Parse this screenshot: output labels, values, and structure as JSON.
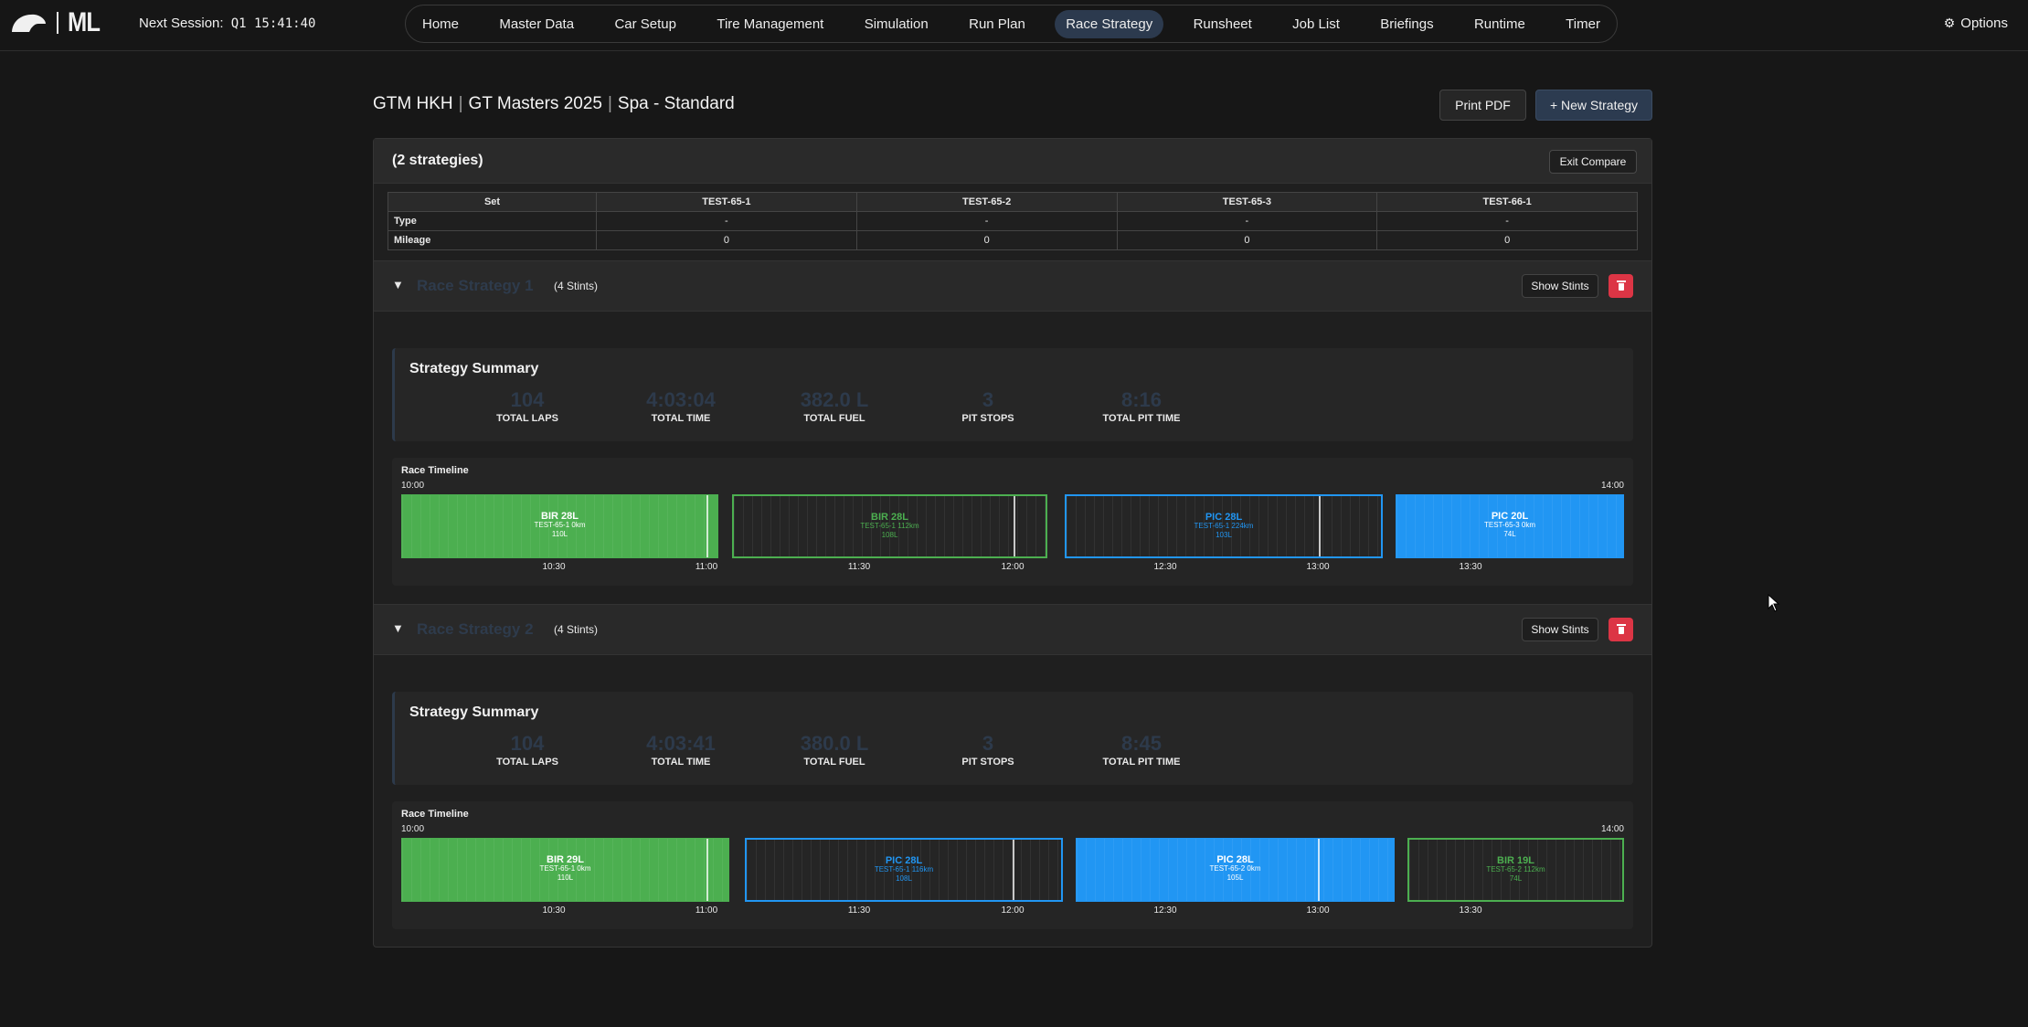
{
  "header": {
    "logo_text": "ML",
    "next_session_label": "Next Session:",
    "next_session_value": "Q1 15:41:40",
    "nav": [
      "Home",
      "Master Data",
      "Car Setup",
      "Tire Management",
      "Simulation",
      "Run Plan",
      "Race Strategy",
      "Runsheet",
      "Job List",
      "Briefings",
      "Runtime",
      "Timer"
    ],
    "active_nav": "Race Strategy",
    "options_label": "Options"
  },
  "page": {
    "crumb_team": "GTM HKH",
    "crumb_series": "GT Masters 2025",
    "crumb_track": "Spa - Standard",
    "print_label": "Print PDF",
    "new_strategy_label": "+ New Strategy"
  },
  "compare": {
    "title": "(2 strategies)",
    "exit_label": "Exit Compare",
    "table": {
      "header_label": "Set",
      "sets": [
        "TEST-65-1",
        "TEST-65-2",
        "TEST-65-3",
        "TEST-66-1"
      ],
      "rows": [
        {
          "label": "Type",
          "values": [
            "-",
            "-",
            "-",
            "-"
          ]
        },
        {
          "label": "Mileage",
          "values": [
            "0",
            "0",
            "0",
            "0"
          ]
        }
      ]
    }
  },
  "strategies": [
    {
      "name": "Race Strategy 1",
      "stints_label": "(4 Stints)",
      "show_stints_label": "Show Stints",
      "summary_title": "Strategy Summary",
      "metrics": [
        {
          "value": "104",
          "label": "TOTAL LAPS"
        },
        {
          "value": "4:03:04",
          "label": "TOTAL TIME"
        },
        {
          "value": "382.0 L",
          "label": "TOTAL FUEL"
        },
        {
          "value": "3",
          "label": "PIT STOPS"
        },
        {
          "value": "8:16",
          "label": "TOTAL PIT TIME"
        }
      ],
      "timeline": {
        "title": "Race Timeline",
        "start": "10:00",
        "end": "14:00",
        "ticks": [
          "10:30",
          "11:00",
          "11:30",
          "12:00",
          "12:30",
          "13:00",
          "13:30"
        ],
        "stints": [
          {
            "title": "BIR 28L",
            "set": "TEST-65-1 0km",
            "fuel": "110L",
            "color": "green",
            "style": "filled"
          },
          {
            "title": "BIR 28L",
            "set": "TEST-65-1 112km",
            "fuel": "108L",
            "color": "green",
            "style": "outline"
          },
          {
            "title": "PIC 28L",
            "set": "TEST-65-1 224km",
            "fuel": "103L",
            "color": "blue",
            "style": "outline"
          },
          {
            "title": "PIC 20L",
            "set": "TEST-65-3 0km",
            "fuel": "74L",
            "color": "blue",
            "style": "filled"
          }
        ]
      }
    },
    {
      "name": "Race Strategy 2",
      "stints_label": "(4 Stints)",
      "show_stints_label": "Show Stints",
      "summary_title": "Strategy Summary",
      "metrics": [
        {
          "value": "104",
          "label": "TOTAL LAPS"
        },
        {
          "value": "4:03:41",
          "label": "TOTAL TIME"
        },
        {
          "value": "380.0 L",
          "label": "TOTAL FUEL"
        },
        {
          "value": "3",
          "label": "PIT STOPS"
        },
        {
          "value": "8:45",
          "label": "TOTAL PIT TIME"
        }
      ],
      "timeline": {
        "title": "Race Timeline",
        "start": "10:00",
        "end": "14:00",
        "ticks": [
          "10:30",
          "11:00",
          "11:30",
          "12:00",
          "12:30",
          "13:00",
          "13:30"
        ],
        "stints": [
          {
            "title": "BIR 29L",
            "set": "TEST-65-1 0km",
            "fuel": "110L",
            "color": "green",
            "style": "filled"
          },
          {
            "title": "PIC 28L",
            "set": "TEST-65-1 116km",
            "fuel": "108L",
            "color": "blue",
            "style": "outline"
          },
          {
            "title": "PIC 28L",
            "set": "TEST-65-2 0km",
            "fuel": "105L",
            "color": "blue",
            "style": "filled"
          },
          {
            "title": "BIR 19L",
            "set": "TEST-65-2 112km",
            "fuel": "74L",
            "color": "green",
            "style": "outline"
          }
        ]
      }
    }
  ],
  "colors": {
    "green": "#4caf50",
    "blue": "#2196f3",
    "accent": "#2c3b50",
    "danger": "#dc3545"
  }
}
